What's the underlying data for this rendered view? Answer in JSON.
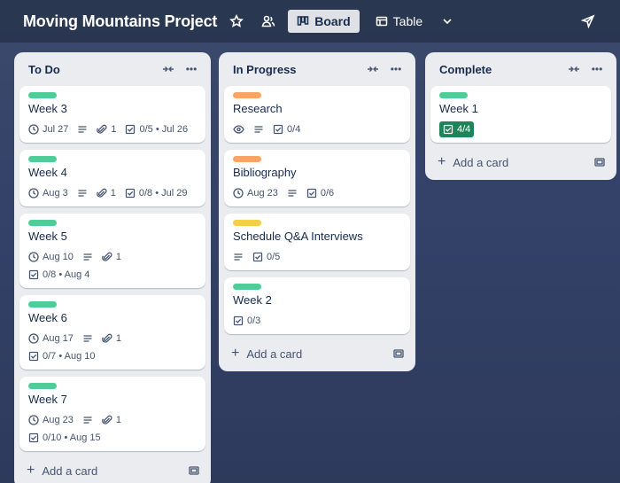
{
  "board": {
    "title": "Moving Mountains Project",
    "views": [
      {
        "label": "Board",
        "icon": "board-icon",
        "active": true
      },
      {
        "label": "Table",
        "icon": "table-icon",
        "active": false
      }
    ]
  },
  "colors": {
    "green": "#4bce97",
    "orange": "#fea362",
    "yellow": "#f5cd47",
    "done_badge": "#1f845a"
  },
  "lists": [
    {
      "title": "To Do",
      "add_card": "Add a card",
      "cards": [
        {
          "title": "Week 3",
          "label": "green",
          "due": "Jul 27",
          "attachments": "1",
          "checklist": "0/5 • Jul 26"
        },
        {
          "title": "Week 4",
          "label": "green",
          "due": "Aug 3",
          "attachments": "1",
          "checklist": "0/8 • Jul 29"
        },
        {
          "title": "Week 5",
          "label": "green",
          "due": "Aug 10",
          "attachments": "1",
          "checklist": "0/8 • Aug 4"
        },
        {
          "title": "Week 6",
          "label": "green",
          "due": "Aug 17",
          "attachments": "1",
          "checklist": "0/7 • Aug 10"
        },
        {
          "title": "Week 7",
          "label": "green",
          "due": "Aug 23",
          "attachments": "1",
          "checklist": "0/10 • Aug 15"
        }
      ]
    },
    {
      "title": "In Progress",
      "add_card": "Add a card",
      "cards": [
        {
          "title": "Research",
          "label": "orange",
          "checklist": "0/4"
        },
        {
          "title": "Bibliography",
          "label": "orange",
          "due": "Aug 23",
          "checklist": "0/6"
        },
        {
          "title": "Schedule Q&A Interviews",
          "label": "yellow",
          "checklist": "0/5"
        },
        {
          "title": "Week 2",
          "label": "green",
          "checklist": "0/3"
        }
      ]
    },
    {
      "title": "Complete",
      "add_card": "Add a card",
      "cards": [
        {
          "title": "Week 1",
          "label": "green",
          "checklist": "4/4"
        }
      ]
    }
  ]
}
